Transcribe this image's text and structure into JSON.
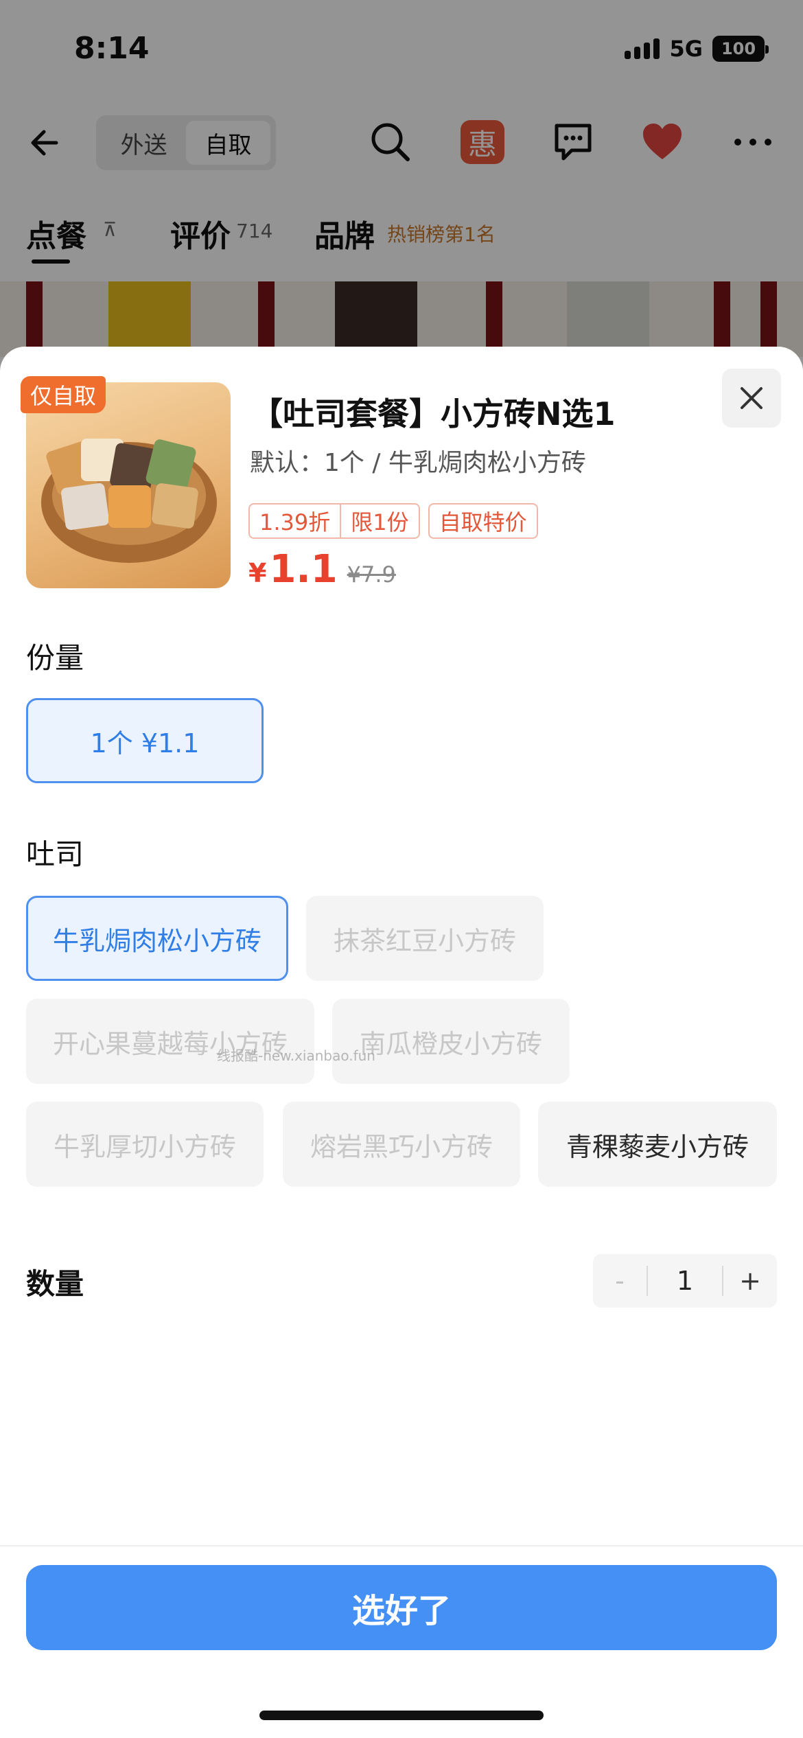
{
  "status_bar": {
    "time": "8:14",
    "network": "5G",
    "battery": "100"
  },
  "nav": {
    "seg_delivery": "外送",
    "seg_pickup": "自取",
    "hui_label": "惠"
  },
  "tabs": {
    "order": "点餐",
    "order_sort_glyph": "⊼",
    "reviews": "评价",
    "reviews_count": "714",
    "brand": "品牌",
    "brand_rank": "热销榜第1名"
  },
  "product": {
    "pickup_only_badge": "仅自取",
    "title": "【吐司套餐】小方砖N选1",
    "default_spec": "默认：1个 / 牛乳焗肉松小方砖",
    "tags": {
      "discount": "1.39折",
      "limit": "限1份",
      "special": "自取特价"
    },
    "currency": "¥",
    "price": "1.1",
    "original_price": "¥7.9"
  },
  "portion": {
    "label": "份量",
    "options": [
      {
        "label": "1个  ¥1.1",
        "state": "selected"
      }
    ]
  },
  "toast": {
    "label": "吐司",
    "options": [
      {
        "label": "牛乳焗肉松小方砖",
        "state": "selected"
      },
      {
        "label": "抹茶红豆小方砖",
        "state": "disabled"
      },
      {
        "label": "开心果蔓越莓小方砖",
        "state": "disabled"
      },
      {
        "label": "南瓜橙皮小方砖",
        "state": "disabled"
      },
      {
        "label": "牛乳厚切小方砖",
        "state": "disabled"
      },
      {
        "label": "熔岩黑巧小方砖",
        "state": "disabled"
      },
      {
        "label": "青稞藜麦小方砖",
        "state": "available"
      }
    ]
  },
  "quantity": {
    "label": "数量",
    "minus": "-",
    "value": "1",
    "plus": "+"
  },
  "footer": {
    "confirm_label": "选好了"
  },
  "watermark": "线报酷-new.xianbao.fun",
  "colors": {
    "accent_blue": "#4590f5",
    "price_red": "#e8412e",
    "badge_orange": "#ef6d2d",
    "heart_red": "#e2463e",
    "hui_red": "#ec5b3c"
  }
}
